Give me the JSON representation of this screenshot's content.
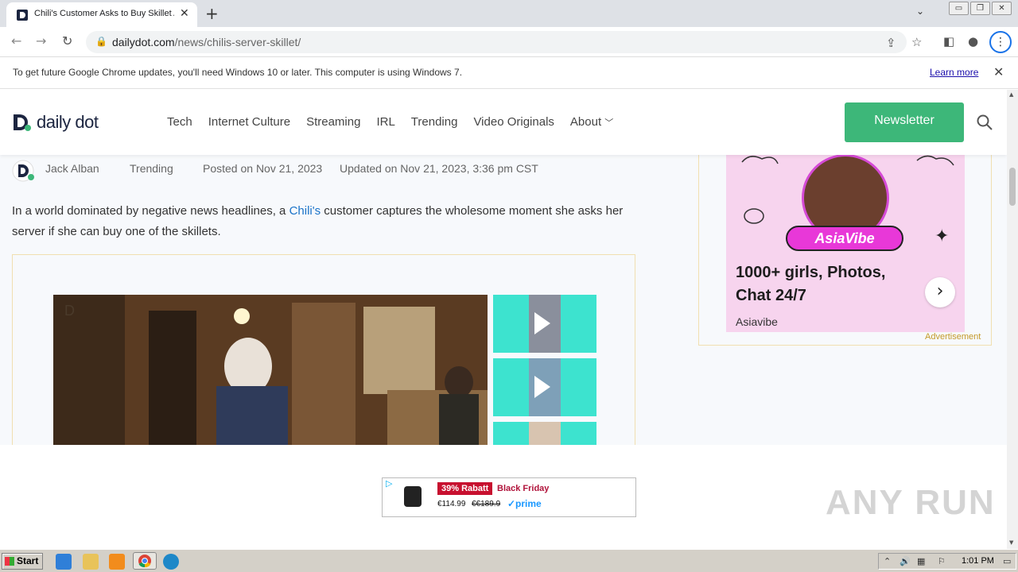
{
  "browser": {
    "tab_title": "Chili's Customer Asks to Buy Skillet A",
    "new_tab": "+",
    "url_domain": "dailydot.com",
    "url_path": "/news/chilis-server-skillet/"
  },
  "infobar": {
    "message": "To get future Google Chrome updates, you'll need Windows 10 or later. This computer is using Windows 7.",
    "learn_more": "Learn more"
  },
  "site": {
    "logo_text": "daily dot",
    "nav": [
      "Tech",
      "Internet Culture",
      "Streaming",
      "IRL",
      "Trending",
      "Video Originals",
      "About"
    ],
    "newsletter": "Newsletter"
  },
  "article": {
    "author": "Jack Alban",
    "category": "Trending",
    "posted": "Posted on Nov 21, 2023",
    "updated": "Updated on Nov 21, 2023, 3:36 pm CST",
    "intro_before": "In a world dominated by negative news headlines, a ",
    "intro_link": "Chili's",
    "intro_after": " customer captures the wholesome moment she asks her server if she can buy one of the skillets."
  },
  "sidebar_ad": {
    "brand": "AsiaVibe",
    "headline": "1000+ girls, Photos, Chat 24/7",
    "advertiser": "Asiavibe",
    "label": "Advertisement"
  },
  "bottom_ad": {
    "discount": "39% Rabatt",
    "event": "Black Friday",
    "price": "€114.99",
    "old_price": "€€189.9",
    "prime": "✓prime"
  },
  "watermark": "ANY RUN",
  "taskbar": {
    "start": "Start",
    "clock": "1:01 PM"
  },
  "colors": {
    "accent_green": "#3db779",
    "link_blue": "#1a73c8",
    "ad_pink": "#f7d4ee"
  }
}
